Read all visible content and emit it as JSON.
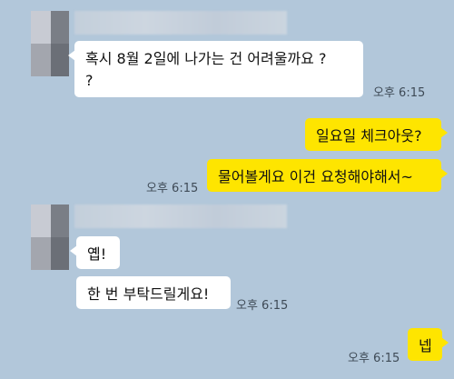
{
  "messages": [
    {
      "text": "혹시 8월 2일에 나가는 건 어려울까요 ?\n?",
      "time": "오후 6:15"
    },
    {
      "text": "일요일 체크아웃?"
    },
    {
      "text": "물어볼게요 이건 요청해야해서~",
      "time": "오후 6:15"
    },
    {
      "text": "옙!"
    },
    {
      "text": "한 번 부탁드릴게요!",
      "time": "오후 6:15"
    },
    {
      "text": "넵",
      "time": "오후 6:15"
    }
  ]
}
